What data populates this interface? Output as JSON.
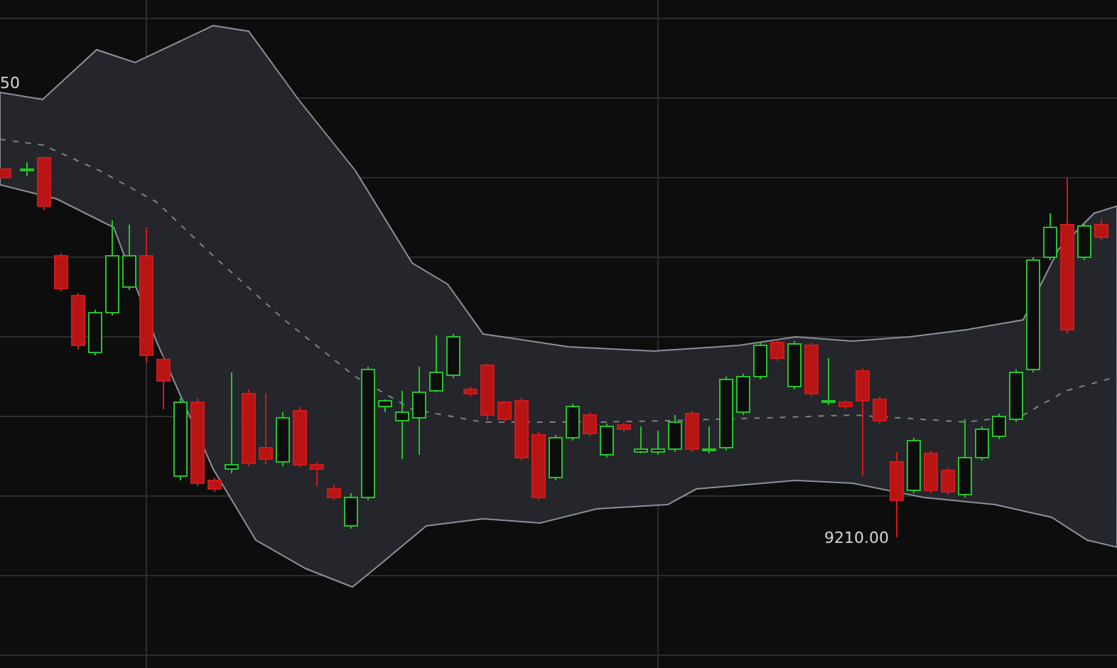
{
  "chart": {
    "price_labels": [
      {
        "text": "50"
      },
      {
        "text": "9210.00"
      }
    ]
  }
}
